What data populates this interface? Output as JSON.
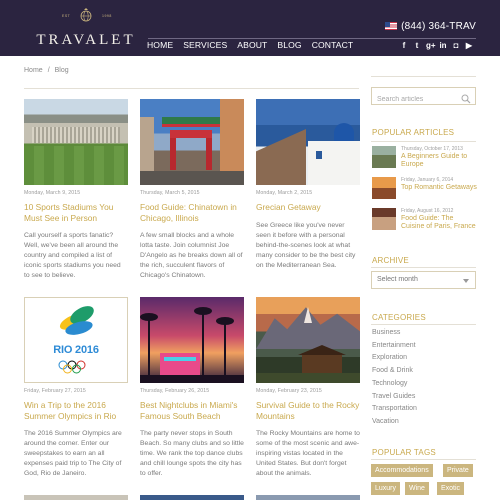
{
  "header": {
    "logo_est": "EST",
    "logo_year": "1998",
    "logo_text": "TRAVALET",
    "phone": "(844) 364-TRAV",
    "nav": [
      "HOME",
      "SERVICES",
      "ABOUT",
      "BLOG",
      "CONTACT"
    ],
    "social": [
      {
        "icon": "facebook-icon",
        "glyph": "f"
      },
      {
        "icon": "twitter-icon",
        "glyph": "t"
      },
      {
        "icon": "googleplus-icon",
        "glyph": "g+"
      },
      {
        "icon": "linkedin-icon",
        "glyph": "in"
      },
      {
        "icon": "instagram-icon",
        "glyph": "◘"
      },
      {
        "icon": "youtube-icon",
        "glyph": "▶"
      }
    ]
  },
  "breadcrumb": {
    "home": "Home",
    "sep": "/",
    "current": "Blog"
  },
  "articles": [
    {
      "date": "Monday, March 9, 2015",
      "title": "10 Sports Stadiums You Must See in Person",
      "body": "Call yourself a sports fanatic? Well, we've been all around the country and compiled a list of iconic sports stadiums you need to see to believe.",
      "image": "stadium"
    },
    {
      "date": "Thursday, March 5, 2015",
      "title": "Food Guide: Chinatown in Chicago, Illinois",
      "body": "A few small blocks and a whole lotta taste. Join columnist Joe D'Angelo as he breaks down all of the rich, succulent flavors of Chicago's Chinatown.",
      "image": "chinatown"
    },
    {
      "date": "Monday, March 2, 2015",
      "title": "Grecian Getaway",
      "body": "See Greece like you've never seen it before with a personal behind-the-scenes look at what many consider to be the best city on the Mediterranean Sea.",
      "image": "greece"
    },
    {
      "date": "Friday, February 27, 2015",
      "title": "Win a Trip to the 2016 Summer Olympics in Rio",
      "body": "The 2016 Summer Olympics are around the corner. Enter our sweepstakes to earn an all expenses paid trip to The City of God, Rio de Janeiro.",
      "image": "rio",
      "badge": "RIO 2016"
    },
    {
      "date": "Thursday, February 26, 2015",
      "title": "Best Nightclubs in Miami's Famous South Beach",
      "body": "The party never stops in South Beach.  So many clubs and so little time. We rank the top dance clubs and chill lounge spots the city has to offer.",
      "image": "miami"
    },
    {
      "date": "Monday, February 23, 2015",
      "title": "Survival Guide to the Rocky Mountains",
      "body": "The Rocky Mountains are home to some of the most scenic and awe-inspiring vistas located in the United States. But don't forget about the animals.",
      "image": "rockies"
    }
  ],
  "sidebar": {
    "search_placeholder": "Search articles",
    "popular_heading": "POPULAR ARTICLES",
    "popular": [
      {
        "date": "Thursday, October 17, 2013",
        "title": "A Beginners Guide to Europe"
      },
      {
        "date": "Friday, January 6, 2014",
        "title": "Top Romantic Getaways"
      },
      {
        "date": "Friday, August 16, 2012",
        "title": "Food Guide: The Cuisine of Paris, France"
      }
    ],
    "archive_heading": "ARCHIVE",
    "archive_selected": "Select month",
    "categories_heading": "CATEGORIES",
    "categories": [
      "Business",
      "Entertainment",
      "Exploration",
      "Food & Drink",
      "Technology",
      "Travel Guides",
      "Transportation",
      "Vacation"
    ],
    "tags_heading": "POPULAR TAGS",
    "tags": [
      "Accommodations",
      "Private",
      "Luxury",
      "Wine",
      "Exotic"
    ]
  },
  "colors": {
    "header": "#2b2440",
    "accent": "#c9a94e",
    "tag": "#cbb67f"
  }
}
